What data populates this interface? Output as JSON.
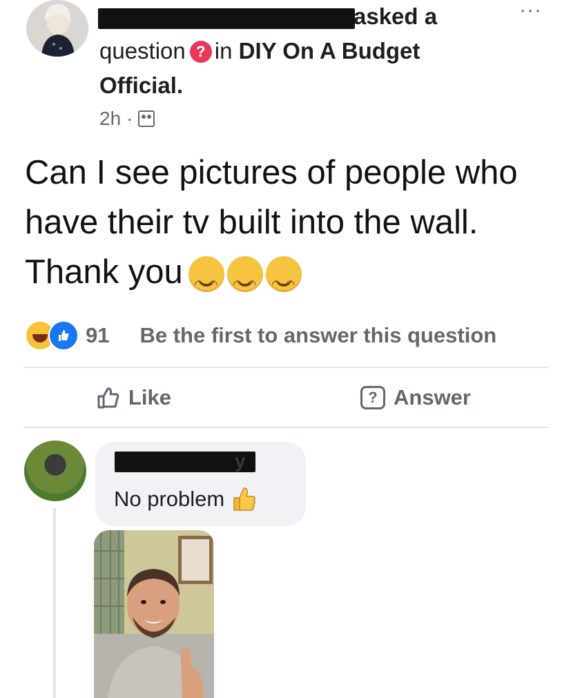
{
  "header": {
    "action_text": "asked a",
    "question_word": "question",
    "question_badge": "?",
    "in_word": "in",
    "group_name_part1": "DIY On A Budget",
    "group_name_part2": "Official.",
    "time": "2h",
    "separator": "·",
    "visibility_icon": "group-members-icon",
    "more_menu": "···"
  },
  "post": {
    "question_text": "Can I see pictures of people who have their tv built into the wall. Thank you",
    "emoji": [
      "smiling-face",
      "smiling-face",
      "smiling-face"
    ]
  },
  "reactions": {
    "icons": [
      "haha-reaction",
      "like-reaction"
    ],
    "count": "91",
    "prompt": "Be the first to answer this question"
  },
  "actions": {
    "like_label": "Like",
    "answer_label": "Answer",
    "answer_icon_glyph": "?"
  },
  "comment": {
    "name_tail": "y",
    "text": "No problem",
    "emoji": "thumbs-up"
  },
  "colors": {
    "text": "#1c1e21",
    "muted": "#65676b",
    "question_badge": "#e8385a",
    "like_blue": "#1877f2",
    "bubble": "#f0f2f5"
  }
}
